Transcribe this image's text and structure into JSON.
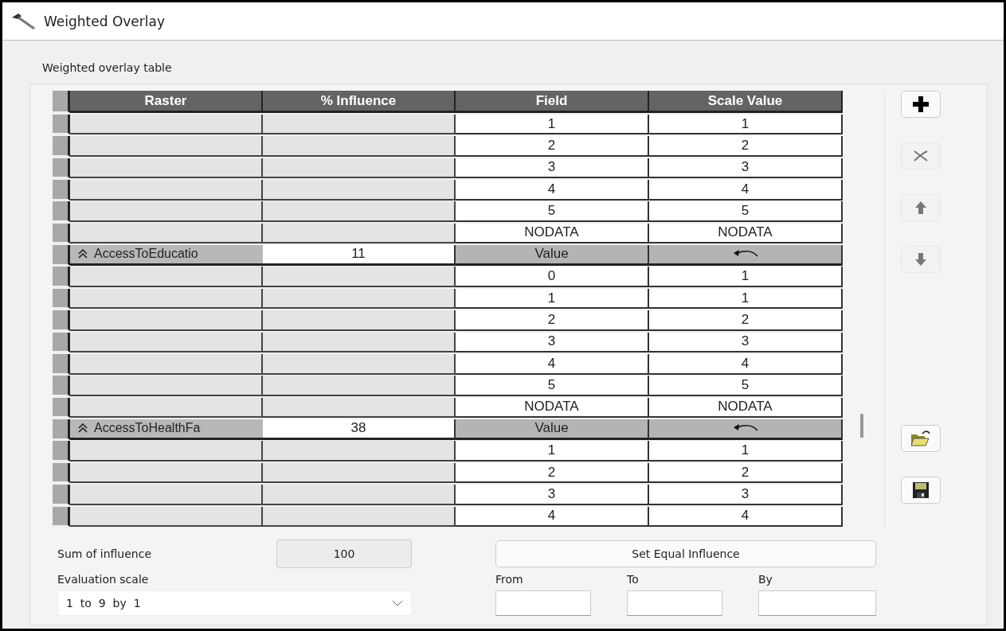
{
  "window": {
    "title": "Weighted Overlay"
  },
  "table_label": "Weighted overlay table",
  "table": {
    "columns": [
      "Raster",
      "% Influence",
      "Field",
      "Scale Value"
    ],
    "rows": [
      {
        "kind": "value",
        "field": "1",
        "scale": "1"
      },
      {
        "kind": "value",
        "field": "2",
        "scale": "2"
      },
      {
        "kind": "value",
        "field": "3",
        "scale": "3"
      },
      {
        "kind": "value",
        "field": "4",
        "scale": "4"
      },
      {
        "kind": "value",
        "field": "5",
        "scale": "5"
      },
      {
        "kind": "value",
        "field": "NODATA",
        "scale": "NODATA"
      },
      {
        "kind": "raster",
        "name": "AccessToEducatio",
        "influence": "11",
        "field": "Value"
      },
      {
        "kind": "value",
        "field": "0",
        "scale": "1"
      },
      {
        "kind": "value",
        "field": "1",
        "scale": "1"
      },
      {
        "kind": "value",
        "field": "2",
        "scale": "2"
      },
      {
        "kind": "value",
        "field": "3",
        "scale": "3"
      },
      {
        "kind": "value",
        "field": "4",
        "scale": "4"
      },
      {
        "kind": "value",
        "field": "5",
        "scale": "5"
      },
      {
        "kind": "value",
        "field": "NODATA",
        "scale": "NODATA"
      },
      {
        "kind": "raster",
        "name": "AccessToHealthFa",
        "influence": "38",
        "field": "Value"
      },
      {
        "kind": "value",
        "field": "1",
        "scale": "1"
      },
      {
        "kind": "value",
        "field": "2",
        "scale": "2"
      },
      {
        "kind": "value",
        "field": "3",
        "scale": "3"
      },
      {
        "kind": "value",
        "field": "4",
        "scale": "4"
      }
    ]
  },
  "side_buttons": [
    {
      "kind": "add",
      "disabled": false
    },
    {
      "kind": "remove",
      "disabled": true
    },
    {
      "kind": "up",
      "disabled": true
    },
    {
      "kind": "down",
      "disabled": true
    },
    {
      "kind": "open",
      "disabled": false
    },
    {
      "kind": "save",
      "disabled": false
    }
  ],
  "sum_label": "Sum of influence",
  "sum_value": "100",
  "equal_button": "Set Equal Influence",
  "scale_label": "Evaluation scale",
  "scale_value": "1  to  9  by  1",
  "range_fields": [
    {
      "label": "From"
    },
    {
      "label": "To"
    },
    {
      "label": "By"
    }
  ]
}
